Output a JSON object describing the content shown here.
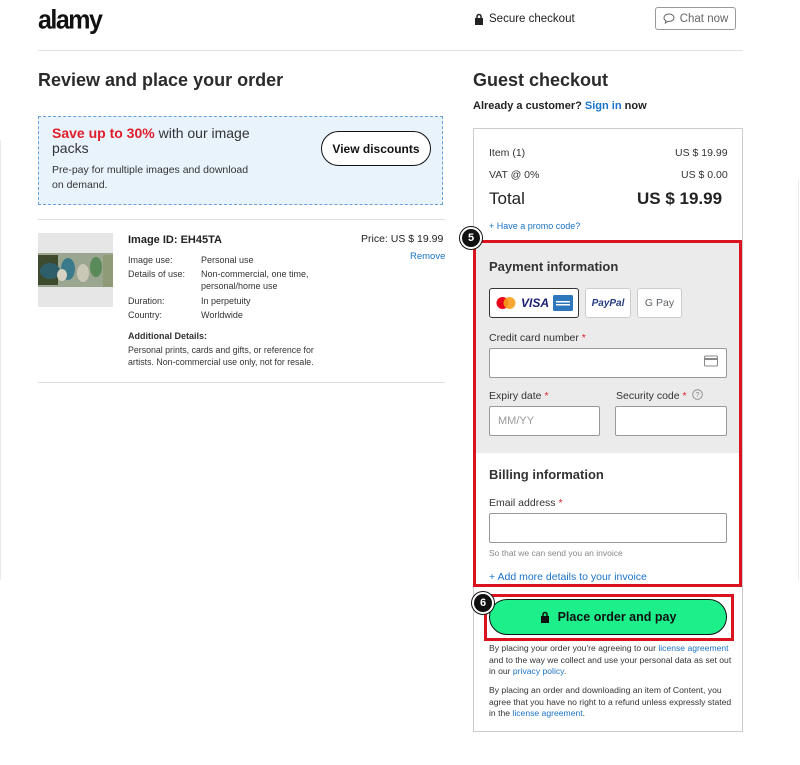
{
  "header": {
    "logo": "alamy",
    "secure_checkout": "Secure checkout",
    "chat_now": "Chat now"
  },
  "main": {
    "title": "Review and place your order",
    "promo": {
      "highlight": "Save up to 30%",
      "rest": " with our image packs",
      "sub": "Pre-pay for multiple images and download on demand.",
      "button": "View discounts"
    },
    "item": {
      "image_id": "Image ID: EH45TA",
      "price": "Price: US $ 19.99",
      "remove": "Remove",
      "details": [
        {
          "k": "Image use:",
          "v": "Personal use"
        },
        {
          "k": "Details of use:",
          "v": "Non-commercial, one time, personal/home use"
        },
        {
          "k": "Duration:",
          "v": "In perpetuity"
        },
        {
          "k": "Country:",
          "v": "Worldwide"
        }
      ],
      "additional_heading": "Additional Details:",
      "additional_text": "Personal prints, cards and gifts, or reference for artists. Non-commercial use only, not for resale."
    }
  },
  "sidebar": {
    "title": "Guest checkout",
    "already_customer": "Already a customer?",
    "sign_in": "Sign in",
    "now": "now",
    "summary": {
      "item_label": "Item (1)",
      "item_value": "US $ 19.99",
      "vat_label": "VAT @ 0%",
      "vat_value": "US $ 0.00",
      "total_label": "Total",
      "total_value": "US $ 19.99"
    },
    "promo_link": "+ Have a promo code?",
    "payment": {
      "title": "Payment information",
      "methods": [
        "VISA",
        "PayPal",
        "G Pay"
      ],
      "card_label": "Credit card number",
      "expiry_label": "Expiry date",
      "expiry_placeholder": "MM/YY",
      "security_label": "Security code",
      "required_mark": "*"
    },
    "billing": {
      "title": "Billing information",
      "email_label": "Email address",
      "hint": "So that we can send you an invoice",
      "more_details": "+ Add more details to your invoice"
    },
    "place_order": "Place order and pay",
    "legal1": {
      "a": "By placing your order you're agreeing to our ",
      "link1": "license agreement",
      "b": " and to the way we collect and use your personal data as set out in our ",
      "link2": "privacy policy",
      "c": "."
    },
    "legal2": {
      "a": "By placing an order and downloading an item of Content, you agree that you have no right to a refund unless expressly stated in the ",
      "link": "license agreement",
      "b": "."
    }
  },
  "annotations": {
    "step5": "5",
    "step6": "6"
  },
  "colors": {
    "highlight_red": "#d9141f",
    "place_button_green": "#1df08b",
    "link_blue": "#1a73c8"
  }
}
